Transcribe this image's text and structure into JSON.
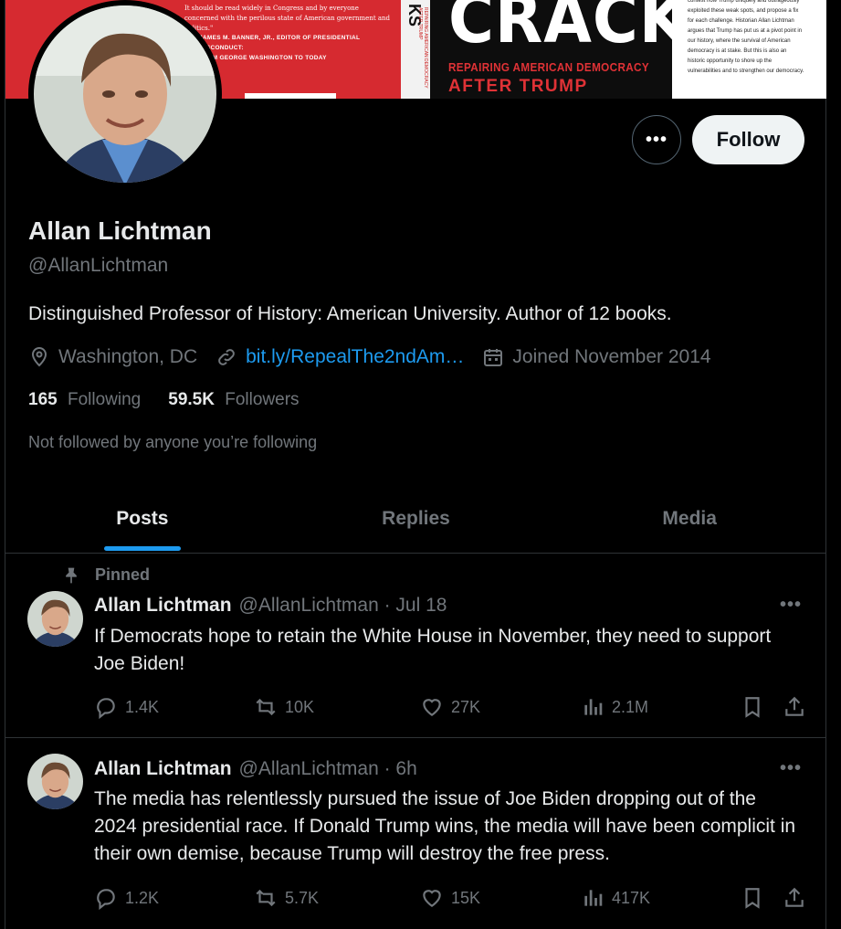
{
  "banner": {
    "quote": "It should be read widely in Congress and by everyone concerned with the perilous state of American government and politics.\"",
    "attribution_1": "JAMES M. BANNER, JR., EDITOR OF PRESIDENTIAL MISCONDUCT:",
    "attribution_2": "FROM GEORGE WASHINGTON TO TODAY",
    "spine_title": "KS",
    "spine_sub": "REPAIRING AMERICAN DEMOCRACY AFTER TRUMP",
    "cover_title": "CRACKS",
    "cover_sub1": "REPAIRING AMERICAN DEMOCRACY",
    "cover_sub2": "AFTER TRUMP",
    "back_text": "contest how Trump uniquely and outrageously exploited these weak spots, and propose a fix for each challenge. Historian Allan Lichtman argues that Trump has put us at a pivot point in our history, where the survival of American democracy is at stake. But this is also an historic opportunity to shore up the vulnerabilities and to strengthen our democracy."
  },
  "actions": {
    "more_label": "•••",
    "follow_label": "Follow"
  },
  "profile": {
    "name": "Allan Lichtman",
    "handle": "@AllanLichtman",
    "bio": "Distinguished Professor of History: American University. Author of 12 books.",
    "location": "Washington, DC",
    "link": "bit.ly/RepealThe2ndAm…",
    "joined": "Joined November 2014",
    "following_count": "165",
    "following_label": "Following",
    "followers_count": "59.5K",
    "followers_label": "Followers",
    "not_followed": "Not followed by anyone you’re following"
  },
  "tabs": [
    {
      "label": "Posts",
      "active": true
    },
    {
      "label": "Replies",
      "active": false
    },
    {
      "label": "Media",
      "active": false
    }
  ],
  "tweets": [
    {
      "pinned_label": "Pinned",
      "name": "Allan Lichtman",
      "meta": "@AllanLichtman · Jul 18",
      "text": "If Democrats hope to retain the White House in November, they need to support Joe Biden!",
      "replies": "1.4K",
      "reposts": "10K",
      "likes": "27K",
      "views": "2.1M"
    },
    {
      "name": "Allan Lichtman",
      "meta": "@AllanLichtman · 6h",
      "text": "The media has relentlessly pursued the issue of Joe Biden dropping out of the 2024 presidential race. If Donald Trump wins, the media will have been complicit in their own demise, because Trump will destroy the free press.",
      "replies": "1.2K",
      "reposts": "5.7K",
      "likes": "15K",
      "views": "417K"
    }
  ],
  "icons": {
    "location": "location-pin-icon",
    "link": "link-icon",
    "calendar": "calendar-icon",
    "pin": "pin-icon",
    "reply": "reply-icon",
    "repost": "repost-icon",
    "like": "heart-icon",
    "views": "views-icon",
    "bookmark": "bookmark-icon",
    "share": "share-icon"
  },
  "colors": {
    "background": "#000000",
    "primary_text": "#e7e9ea",
    "secondary_text": "#71767b",
    "accent": "#1d9bf0",
    "border": "#2f3336"
  }
}
